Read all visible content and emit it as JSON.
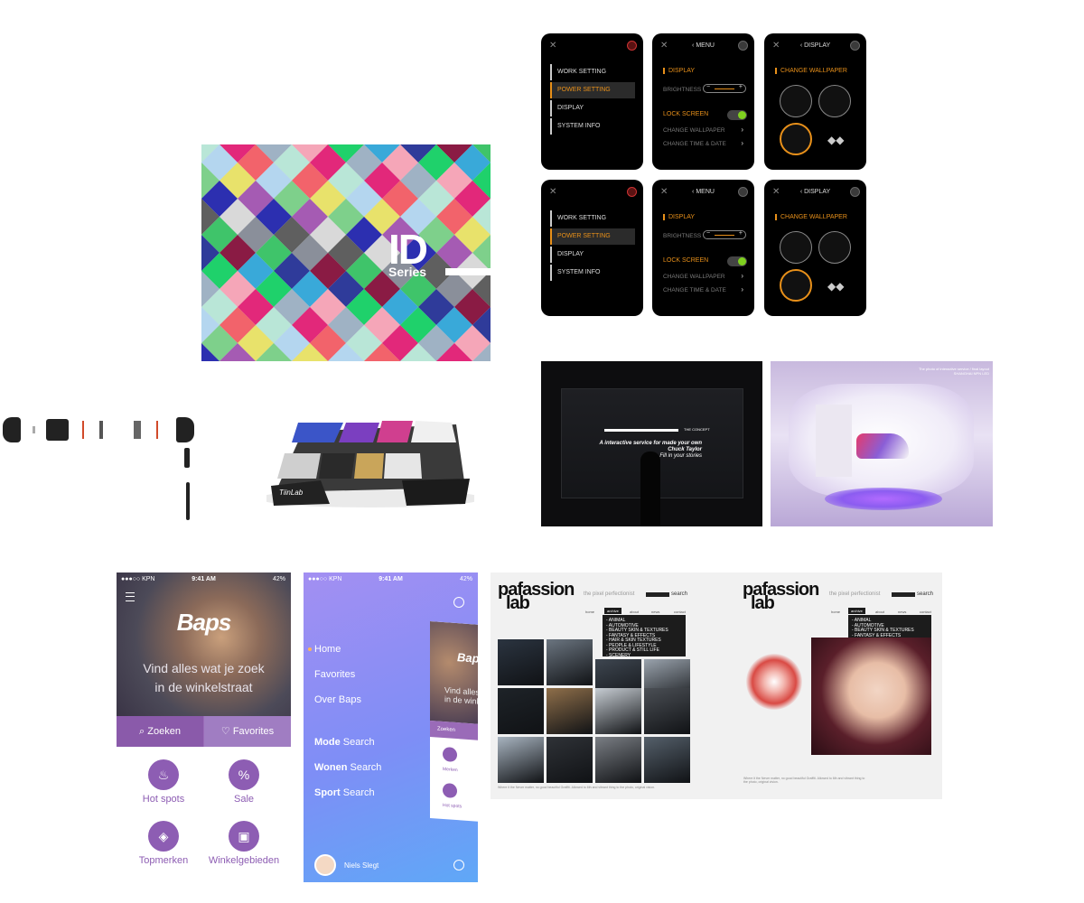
{
  "id_series": {
    "title": "ID",
    "subtitle": "Series"
  },
  "watch": {
    "menu_items": [
      "WORK SETTING",
      "POWER SETTING",
      "DISPLAY",
      "SYSTEM INFO"
    ],
    "menu_header": "MENU",
    "display_header": "DISPLAY",
    "display_label": "DISPLAY",
    "brightness_label": "BRIGHTNESS",
    "minus": "−",
    "plus": "+",
    "lock_screen": "LOCK SCREEN",
    "change_wallpaper": "CHANGE WALLPAPER",
    "change_time": "CHANGE TIME & DATE",
    "back_icon": "chevron-left-icon",
    "close_icon": "close-icon",
    "accent": "#e8901a",
    "toggle_color": "#7fd11f"
  },
  "stand": {
    "brand": "TiinLab"
  },
  "concept": {
    "small": "THE CONCEPT",
    "line1": "A interactive service for made your own",
    "line2": "Chuck Taylor",
    "line3": "Fill in your stories"
  },
  "store": {
    "caption_line1": "The photo of interactive service / final layout",
    "caption_line2": "SHANGHAI NPN LED"
  },
  "baps_home": {
    "status": {
      "carrier": "●●●○○ KPN",
      "time": "9:41 AM",
      "battery": "42%"
    },
    "logo": "Baps",
    "tagline_line1": "Vind alles wat je zoek",
    "tagline_line2": "in de winkelstraat",
    "tab_search": "Zoeken",
    "tab_favorites": "Favorites",
    "tiles": [
      "Hot spots",
      "Sale",
      "Topmerken",
      "Winkelgebieden"
    ],
    "purple": "#8d5db3"
  },
  "baps_menu": {
    "status": {
      "carrier": "●●●○○ KPN",
      "time": "9:41 AM",
      "battery": "42%"
    },
    "items": [
      "Home",
      "Favorites",
      "Over Baps"
    ],
    "search_items": [
      {
        "bold": "Mode",
        "rest": "Search"
      },
      {
        "bold": "Wonen",
        "rest": "Search"
      },
      {
        "bold": "Sport",
        "rest": "Search"
      }
    ],
    "user": "Niels Slegt",
    "peek_logo": "Bap",
    "peek_tag": "Vind alles\nin de winkel",
    "peek_search": "Zoeken",
    "peek_labels": [
      "Merken",
      "Hot spots"
    ],
    "gear_icon": "gear-icon",
    "logout_icon": "logout-icon"
  },
  "pafassion": {
    "logo_line1": "pafassion",
    "logo_line2": "lab",
    "tagline": "the pixel perfectionist",
    "search": "search",
    "nav": [
      "home",
      "archive",
      "about",
      "news",
      "contact"
    ],
    "dropdown": [
      "- ANIMAL",
      "- AUTOMOTIVE",
      "- BEAUTY SKIN & TEXTURES",
      "- FANTASY & EFFECTS",
      "- HAIR & SKIN TEXTURES",
      "- PEOPLE & LIFESTYLE",
      "- PRODUCT & STILL LIFE",
      "- SCENERY",
      "- SPORT"
    ],
    "footer": "Where it the Never matter, no good beautiful Graffiti. Allowed to 6th and vibrant thing to the photo, original vision."
  }
}
